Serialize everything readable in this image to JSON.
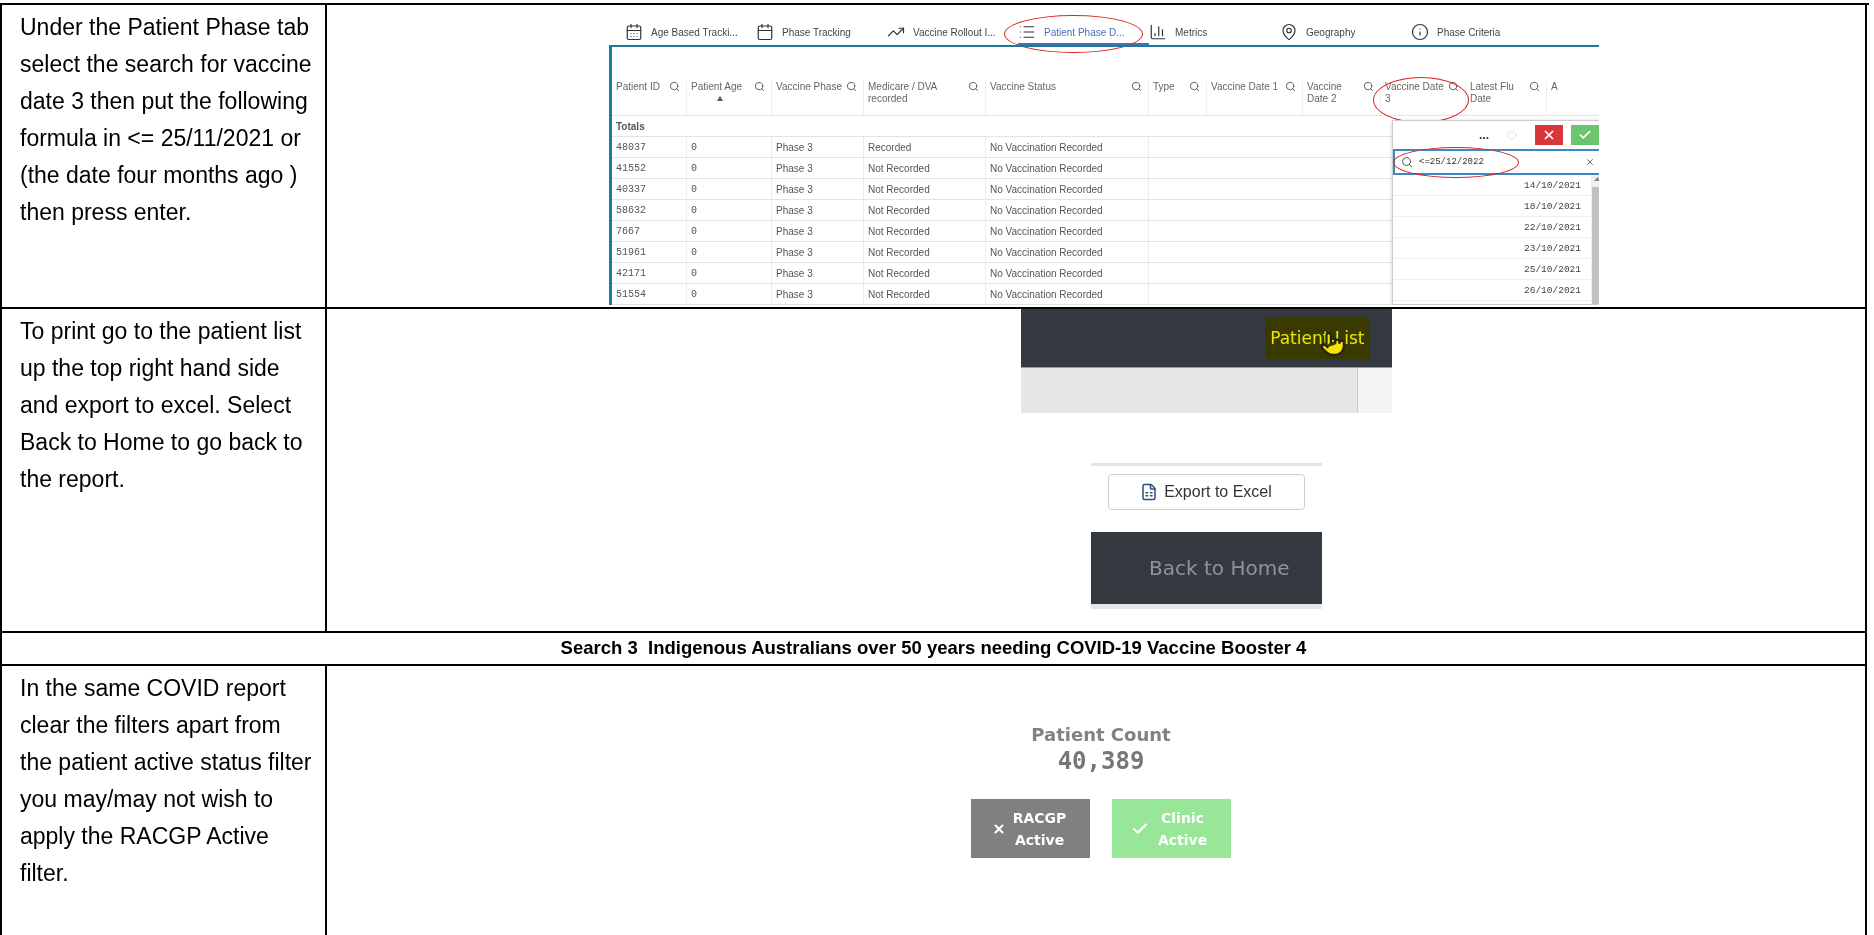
{
  "step_1": {
    "instruction": "Under the Patient Phase tab select the search for vaccine date 3 then put the following formula in <= 25/11/2021 or (the date four months ago ) then press enter.",
    "app": {
      "tabs": [
        {
          "label": "Age Based Tracki...",
          "selected": false,
          "circled": false
        },
        {
          "label": "Phase Tracking",
          "selected": false,
          "circled": false
        },
        {
          "label": "Vaccine Rollout I...",
          "selected": false,
          "circled": false
        },
        {
          "label": "Patient Phase D...",
          "selected": true,
          "circled": true
        },
        {
          "label": "Metrics",
          "selected": false,
          "circled": false
        },
        {
          "label": "Geography",
          "selected": false,
          "circled": false
        },
        {
          "label": "Phase Criteria",
          "selected": false,
          "circled": false
        }
      ],
      "columns": [
        {
          "label": "Patient ID",
          "sorted": false,
          "circled": false
        },
        {
          "label": "Patient Age",
          "sorted": true,
          "circled": false
        },
        {
          "label": "Vaccine Phase",
          "sorted": false,
          "circled": false
        },
        {
          "label": "Medicare / DVA recorded",
          "sorted": false,
          "circled": false
        },
        {
          "label": "Vaccine Status",
          "sorted": false,
          "circled": false
        },
        {
          "label": "Type",
          "sorted": false,
          "circled": false
        },
        {
          "label": "Vaccine Date 1",
          "sorted": false,
          "circled": false
        },
        {
          "label": "Vaccine Date 2",
          "sorted": false,
          "circled": false
        },
        {
          "label": "Vaccine Date 3",
          "sorted": false,
          "circled": true
        },
        {
          "label": "Latest Flu Date",
          "sorted": false,
          "circled": false
        },
        {
          "label": "A",
          "sorted": false,
          "circled": false
        }
      ],
      "totals_label": "Totals",
      "rows": [
        [
          "48037",
          "0",
          "Phase 3",
          "Recorded",
          "No Vaccination Recorded"
        ],
        [
          "41552",
          "0",
          "Phase 3",
          "Not Recorded",
          "No Vaccination Recorded"
        ],
        [
          "40337",
          "0",
          "Phase 3",
          "Not Recorded",
          "No Vaccination Recorded"
        ],
        [
          "58632",
          "0",
          "Phase 3",
          "Not Recorded",
          "No Vaccination Recorded"
        ],
        [
          "7667",
          "0",
          "Phase 3",
          "Not Recorded",
          "No Vaccination Recorded"
        ],
        [
          "51961",
          "0",
          "Phase 3",
          "Not Recorded",
          "No Vaccination Recorded"
        ],
        [
          "42171",
          "0",
          "Phase 3",
          "Not Recorded",
          "No Vaccination Recorded"
        ],
        [
          "51554",
          "0",
          "Phase 3",
          "Not Recorded",
          "No Vaccination Recorded"
        ]
      ],
      "filter": {
        "menu": "...",
        "value": "<=25/12/2022",
        "circled": true,
        "dates": [
          "14/10/2021",
          "18/10/2021",
          "22/10/2021",
          "23/10/2021",
          "25/10/2021",
          "26/10/2021"
        ]
      }
    }
  },
  "step_2": {
    "instruction": "To print go to the patient list up the top right hand side and export to excel. Select Back to Home to go back to the report.",
    "patient_list_button": "Patient List",
    "export_button": "Export to Excel",
    "home_button": "Back to Home"
  },
  "heading": "Search 3  Indigenous Australians over 50 years needing COVID-19 Vaccine Booster 4",
  "step_3": {
    "instruction": "In the same COVID report clear the filters apart from the patient active status filter you may/may not wish to apply the RACGP Active filter.",
    "count_label": "Patient Count",
    "count": "40,389",
    "filters": [
      {
        "label": "RACGP Active",
        "selected": false
      },
      {
        "label": "Clinic Active",
        "selected": true
      }
    ]
  }
}
